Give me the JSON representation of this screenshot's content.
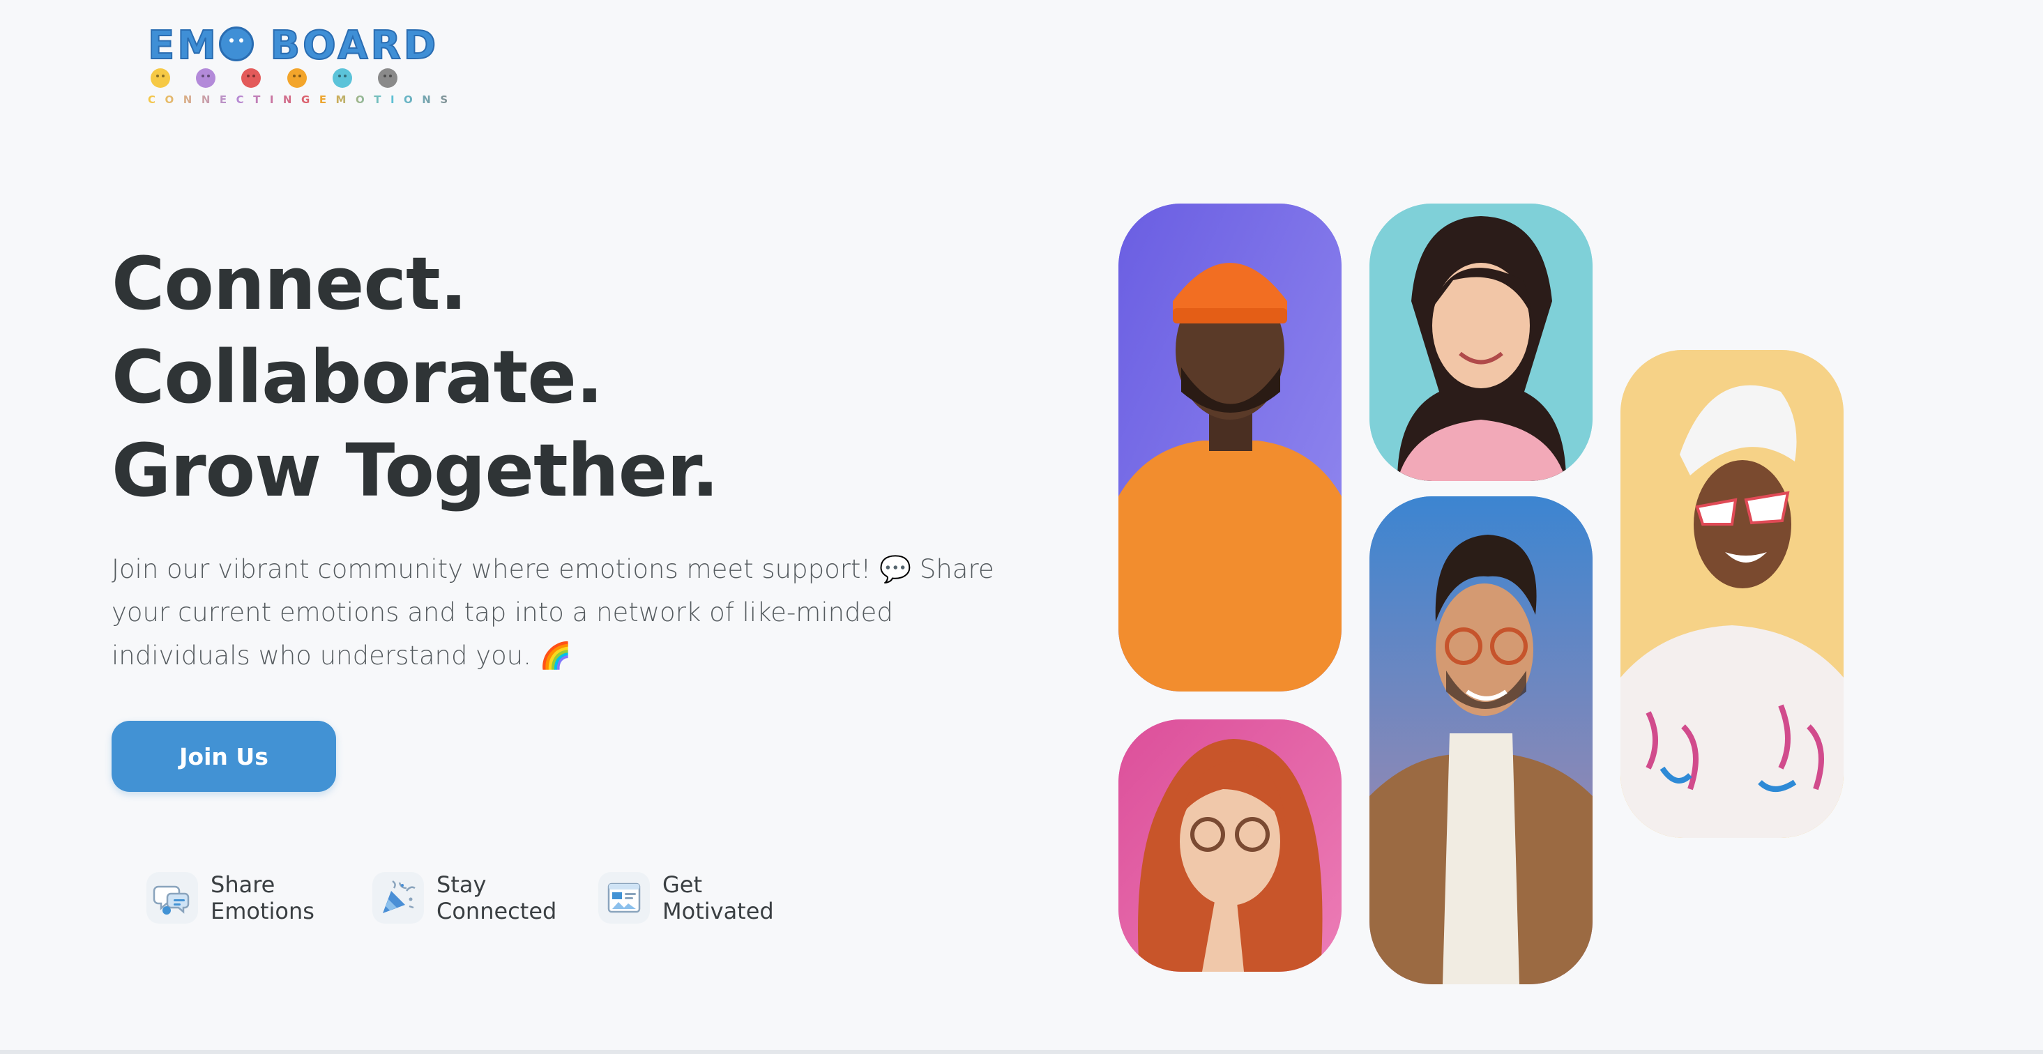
{
  "logo": {
    "word_before": "EM",
    "word_after": " BOARD",
    "tagline_left": "CONNECTING",
    "tagline_right": "EMOTIONS",
    "face_colors": [
      "#f6c945",
      "#b38ad9",
      "#e35a5a",
      "#f3a52b",
      "#5bc3d9",
      "#8a8a8a"
    ],
    "tagline_colors": [
      "#f6c945",
      "#b38ad9",
      "#e35a5a",
      "#f3a52b",
      "#5bc3d9",
      "#8a8a8a"
    ]
  },
  "hero": {
    "headline_lines": [
      "Connect.",
      "Collaborate.",
      "Grow Together."
    ],
    "description": "Join our vibrant community where emotions meet support! 💬 Share your current emotions and tap into a network of like-minded individuals who understand you. 🌈",
    "cta_label": "Join Us"
  },
  "features": [
    {
      "label": "Share Emotions",
      "icon": "chat-bubble-icon"
    },
    {
      "label": "Stay Connected",
      "icon": "party-popper-icon"
    },
    {
      "label": "Get Motivated",
      "icon": "news-board-icon"
    }
  ],
  "photos": [
    {
      "name": "man-orange-beanie-photo",
      "bg": "#7a6ce6"
    },
    {
      "name": "smiling-woman-pink-sweater-photo",
      "bg": "#7fd0d8"
    },
    {
      "name": "woman-white-sunglasses-towel-photo",
      "bg": "#f6d287"
    },
    {
      "name": "man-glasses-turtleneck-photo",
      "bg": "#3e86d0"
    },
    {
      "name": "redhead-woman-glasses-photo",
      "bg": "#e0549e"
    }
  ],
  "colors": {
    "primary": "#4292d4",
    "heading": "#2f3436",
    "body_text": "#555b5f",
    "background": "#f7f8fa"
  }
}
